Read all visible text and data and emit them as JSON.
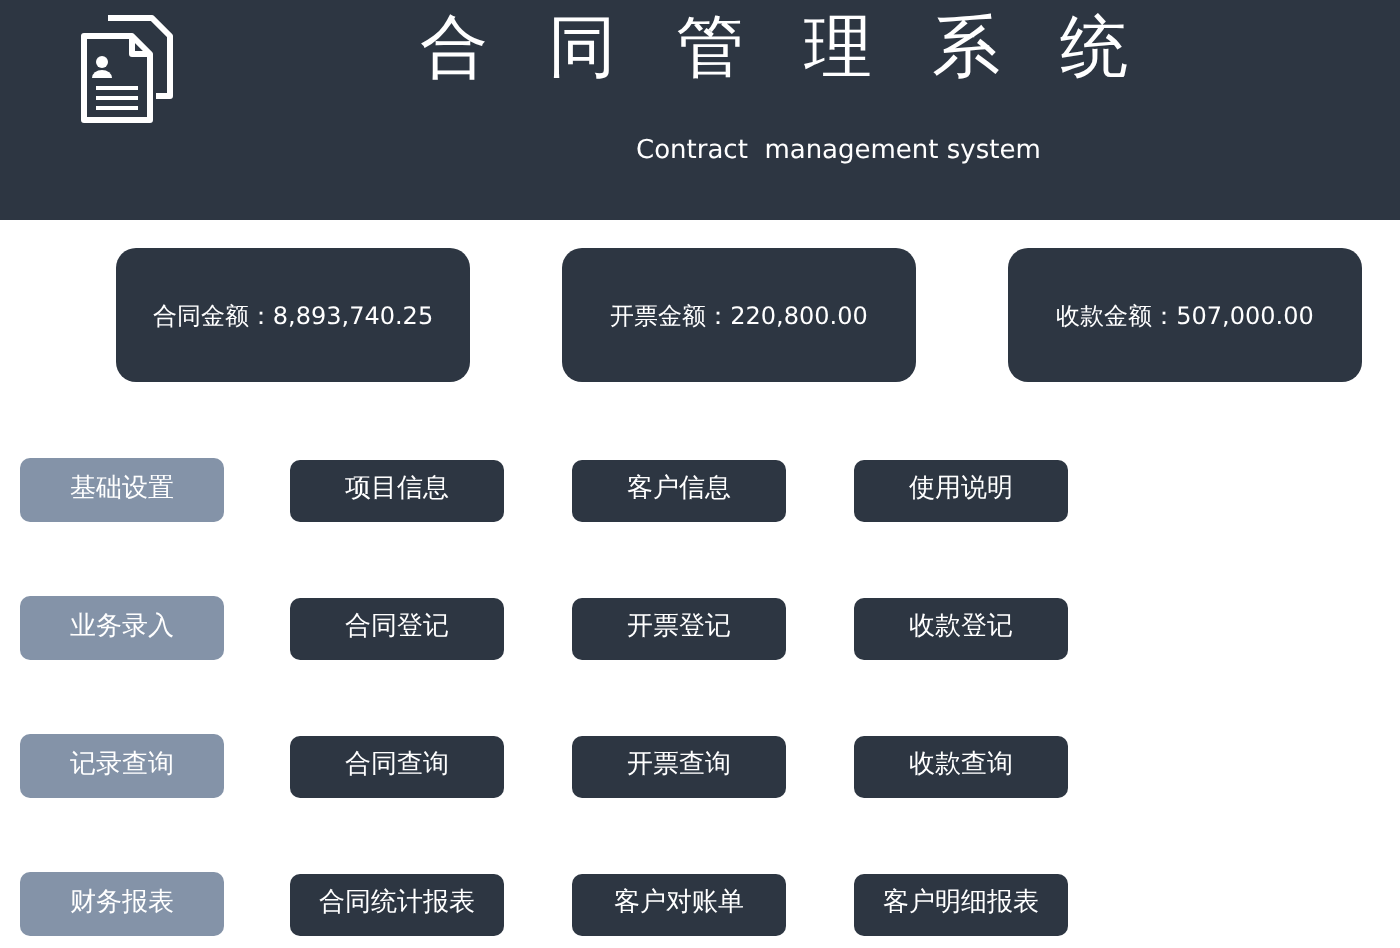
{
  "header": {
    "title": "合同管理系统",
    "subtitle": "Contract  management system"
  },
  "stats": [
    {
      "label": "合同金额：8,893,740.25"
    },
    {
      "label": "开票金额：220,800.00"
    },
    {
      "label": "收款金额：507,000.00"
    }
  ],
  "menu_rows": [
    {
      "category": "基础设置",
      "buttons": [
        "项目信息",
        "客户信息",
        "使用说明"
      ]
    },
    {
      "category": "业务录入",
      "buttons": [
        "合同登记",
        "开票登记",
        "收款登记"
      ]
    },
    {
      "category": "记录查询",
      "buttons": [
        "合同查询",
        "开票查询",
        "收款查询"
      ]
    },
    {
      "category": "财务报表",
      "buttons": [
        "合同统计报表",
        "客户对账单",
        "客户明细报表"
      ]
    }
  ]
}
